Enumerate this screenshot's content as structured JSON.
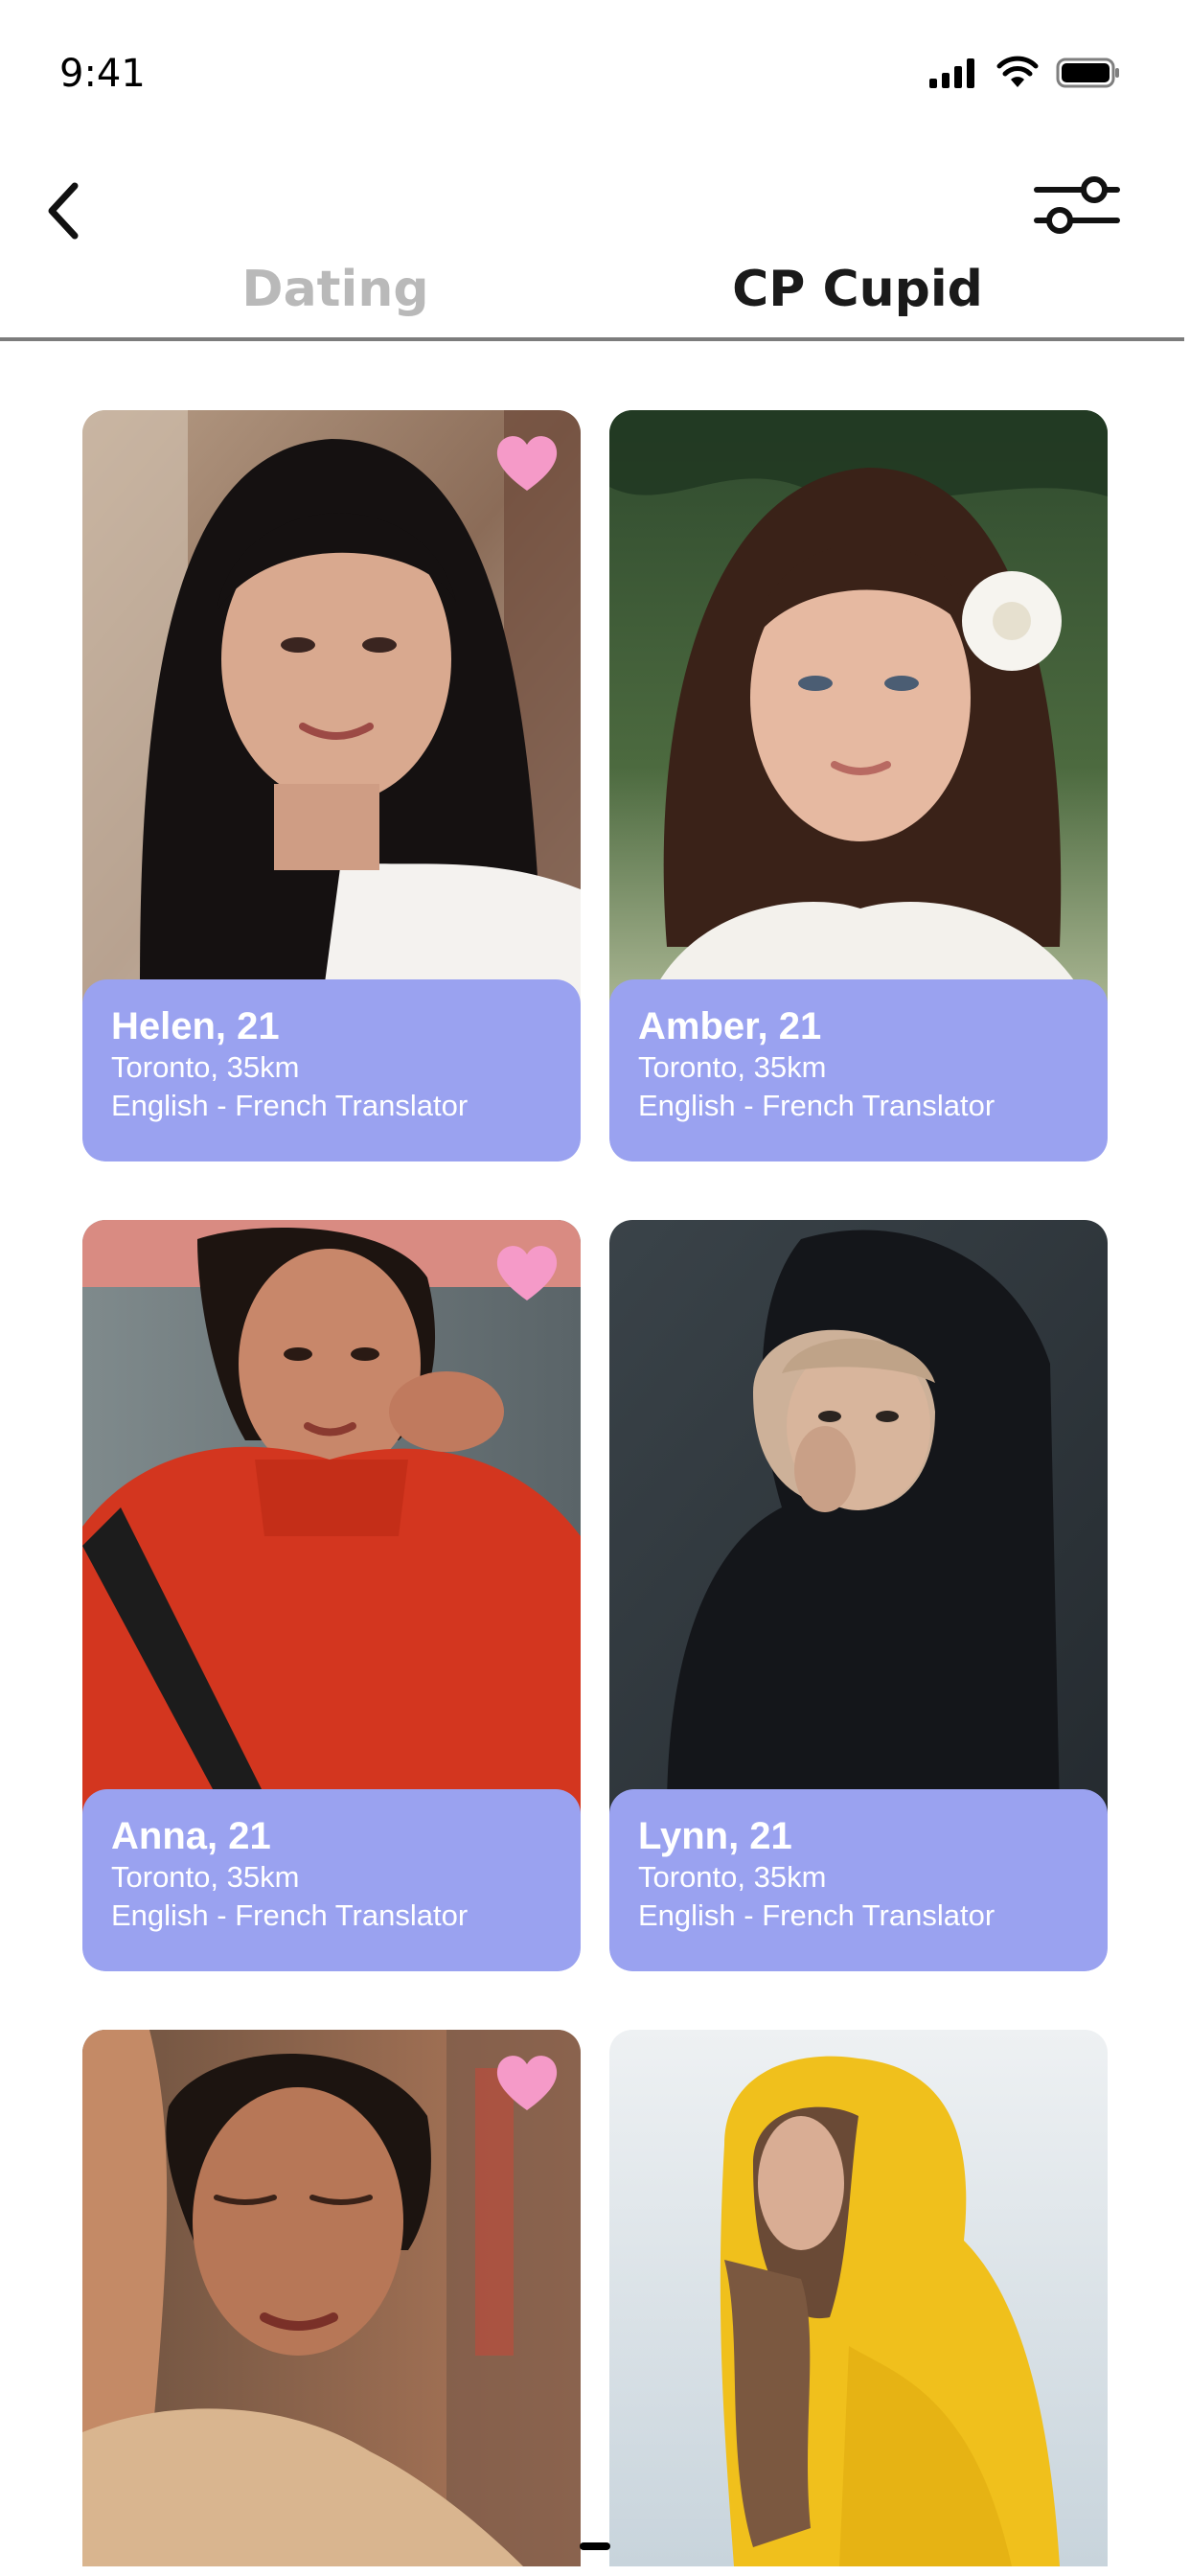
{
  "status_bar": {
    "time": "9:41",
    "icons": [
      "signal-icon",
      "wifi-icon",
      "battery-icon"
    ]
  },
  "header": {
    "back_icon": "chevron-left-icon",
    "filter_icon": "sliders-icon"
  },
  "tabs": [
    {
      "label": "Dating",
      "active": false
    },
    {
      "label": "CP Cupid",
      "active": true
    }
  ],
  "colors": {
    "card_info_bg": "#9aa2f0",
    "heart": "#f59ac8",
    "inactive_tab": "#b9b9b9",
    "active_tab": "#1a1a1a",
    "divider": "#7c7c7c"
  },
  "profiles": [
    {
      "name": "Helen, 21",
      "location": "Toronto, 35km",
      "occupation": "English - French Translator",
      "liked": true
    },
    {
      "name": "Amber, 21",
      "location": "Toronto, 35km",
      "occupation": "English - French Translator",
      "liked": false
    },
    {
      "name": "Anna, 21",
      "location": "Toronto, 35km",
      "occupation": "English - French Translator",
      "liked": true
    },
    {
      "name": "Lynn, 21",
      "location": "Toronto, 35km",
      "occupation": "English - French Translator",
      "liked": false
    },
    {
      "name": "",
      "location": "",
      "occupation": "",
      "liked": true
    },
    {
      "name": "",
      "location": "",
      "occupation": "",
      "liked": false
    }
  ]
}
